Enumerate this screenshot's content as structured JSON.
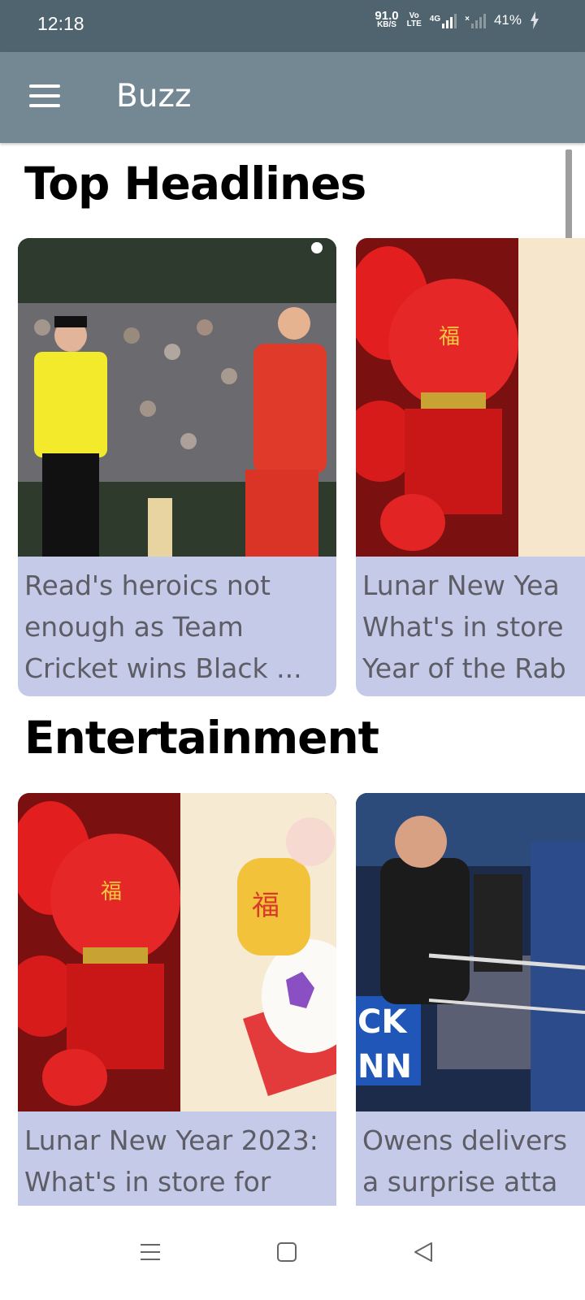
{
  "status_bar": {
    "time": "12:18",
    "net_speed_value": "91.0",
    "net_speed_unit": "KB/S",
    "volte_top": "Vo",
    "volte_bottom": "LTE",
    "network_type": "4G",
    "battery_percent": "41%"
  },
  "app_bar": {
    "title": "Buzz",
    "menu_icon": "hamburger-menu-icon"
  },
  "sections": [
    {
      "title": "Top Headlines",
      "cards": [
        {
          "title_lines": [
            "Read's heroics not",
            "enough as Team",
            "Cricket wins Black ..."
          ],
          "image": "cricket-match-photo"
        },
        {
          "title_lines": [
            "Lunar New Yea",
            "What's in store",
            "Year of the Rab"
          ],
          "image": "red-lanterns-photo"
        }
      ]
    },
    {
      "title": "Entertainment",
      "cards": [
        {
          "title_lines": [
            "Lunar New Year 2023:",
            "What's in store for"
          ],
          "image": "lanterns-and-lucky-cat-photo"
        },
        {
          "title_lines": [
            "Owens delivers",
            "a surprise atta"
          ],
          "image": "wrestling-ring-photo"
        }
      ]
    }
  ],
  "nav_bar": {
    "recents_icon": "recents-icon",
    "home_icon": "home-icon",
    "back_icon": "back-icon"
  },
  "colors": {
    "status_bar_bg": "#4f646e",
    "app_bar_bg": "#738892",
    "card_caption_bg": "#c5cae9",
    "caption_text": "#5d5d66"
  }
}
